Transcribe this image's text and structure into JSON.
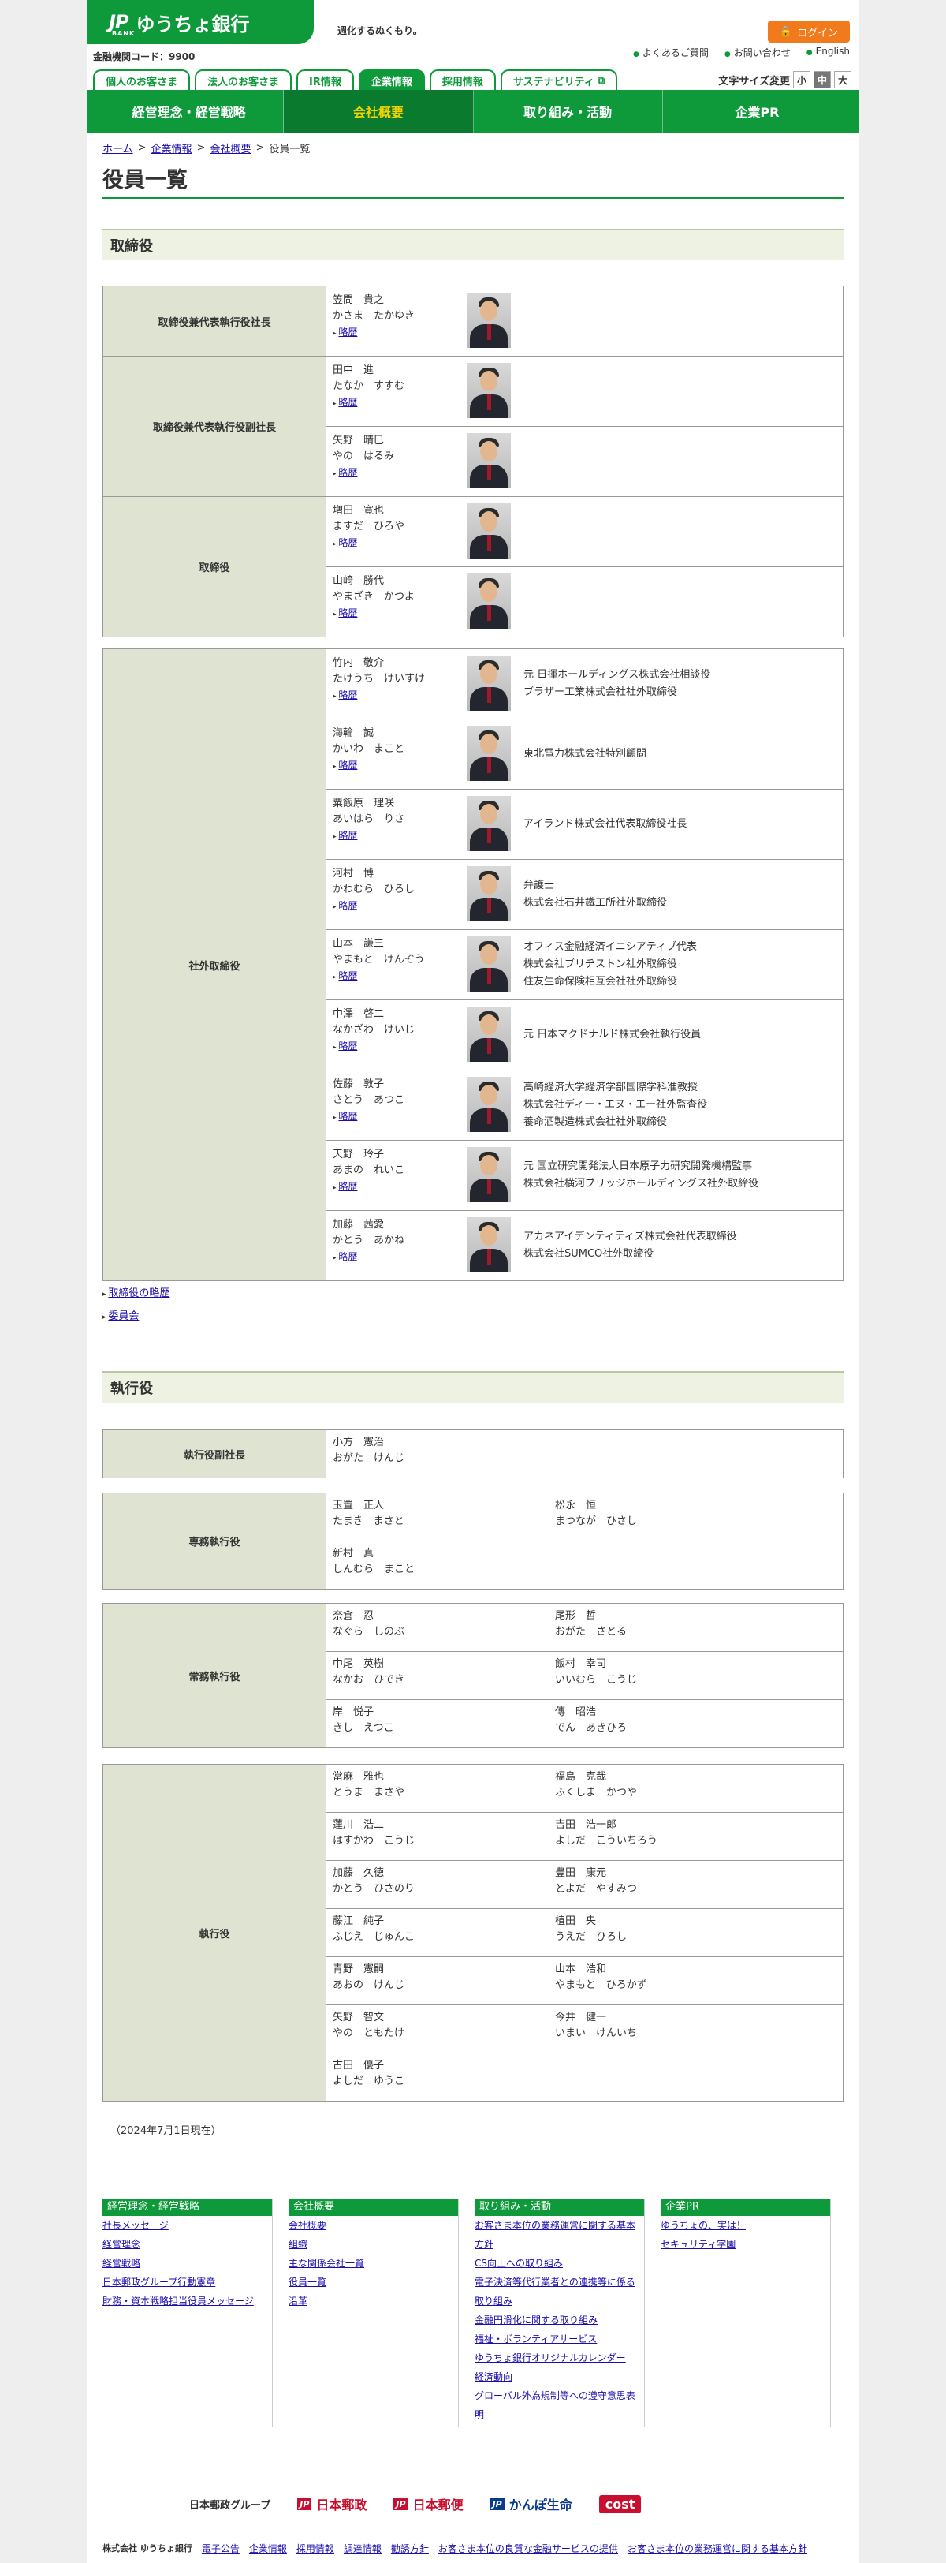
{
  "header": {
    "logo_mark": "JP",
    "logo_sub": "BANK",
    "bank_name": "ゆうちょ銀行",
    "tagline": "週化するぬくもり。",
    "fi_code": "金融機関コード：9900",
    "login": "ログイン",
    "util": [
      "よくあるご質問",
      "お問い合わせ",
      "English"
    ],
    "tabs": [
      "個人のお客さま",
      "法人のお客さま",
      "IR情報",
      "企業情報",
      "採用情報",
      "サステナビリティ"
    ],
    "font_size_label": "文字サイズ変更",
    "font_sizes": [
      "小",
      "中",
      "大"
    ],
    "nav": [
      "経営理念・経営戦略",
      "会社概要",
      "取り組み・活動",
      "企業PR"
    ]
  },
  "breadcrumb": [
    "ホーム",
    "企業情報",
    "会社概要",
    "役員一覧"
  ],
  "title": "役員一覧",
  "board": {
    "heading": "取締役",
    "history": "略歴",
    "groups": [
      {
        "role": "取締役兼代表執行役社長",
        "people": [
          {
            "name": "笠間　貴之",
            "reading": "かさま　たかゆき"
          }
        ]
      },
      {
        "role": "取締役兼代表執行役副社長",
        "people": [
          {
            "name": "田中　進",
            "reading": "たなか　すすむ"
          },
          {
            "name": "矢野　晴巳",
            "reading": "やの　はるみ"
          }
        ]
      },
      {
        "role": "取締役",
        "people": [
          {
            "name": "増田　寛也",
            "reading": "ますだ　ひろや"
          },
          {
            "name": "山崎　勝代",
            "reading": "やまざき　かつよ"
          }
        ]
      }
    ],
    "outside": {
      "role": "社外取締役",
      "people": [
        {
          "name": "竹内　敬介",
          "reading": "たけうち　けいすけ",
          "career": [
            "元 日揮ホールディングス株式会社相談役",
            "ブラザー工業株式会社社外取締役"
          ]
        },
        {
          "name": "海輪　誠",
          "reading": "かいわ　まこと",
          "career": [
            "東北電力株式会社特別顧問"
          ]
        },
        {
          "name": "粟飯原　理咲",
          "reading": "あいはら　りさ",
          "career": [
            "アイランド株式会社代表取締役社長"
          ]
        },
        {
          "name": "河村　博",
          "reading": "かわむら　ひろし",
          "career": [
            "弁護士",
            "株式会社石井鐵工所社外取締役"
          ]
        },
        {
          "name": "山本　謙三",
          "reading": "やまもと　けんぞう",
          "career": [
            "オフィス金融経済イニシアティブ代表",
            "株式会社ブリヂストン社外取締役",
            "住友生命保険相互会社社外取締役"
          ]
        },
        {
          "name": "中澤　啓二",
          "reading": "なかざわ　けいじ",
          "career": [
            "元 日本マクドナルド株式会社執行役員"
          ]
        },
        {
          "name": "佐藤　敦子",
          "reading": "さとう　あつこ",
          "career": [
            "高崎経済大学経済学部国際学科准教授",
            "株式会社ディー・エヌ・エー社外監査役",
            "養命酒製造株式会社社外取締役"
          ]
        },
        {
          "name": "天野　玲子",
          "reading": "あまの　れいこ",
          "career": [
            "元 国立研究開発法人日本原子力研究開発機構監事",
            "株式会社横河ブリッジホールディングス社外取締役"
          ]
        },
        {
          "name": "加藤　茜愛",
          "reading": "かとう　あかね",
          "career": [
            "アカネアイデンティティズ株式会社代表取締役",
            "株式会社SUMCO社外取締役"
          ]
        }
      ]
    },
    "links": [
      "取締役の略歴",
      "委員会"
    ]
  },
  "exec": {
    "heading": "執行役",
    "groups": [
      {
        "role": "執行役副社長",
        "people": [
          {
            "name": "小方　憲治",
            "reading": "おがた　けんじ"
          }
        ]
      },
      {
        "role": "専務執行役",
        "people": [
          {
            "name": "玉置　正人",
            "reading": "たまき　まさと"
          },
          {
            "name": "松永　恒",
            "reading": "まつなが　ひさし"
          },
          {
            "name": "新村　真",
            "reading": "しんむら　まこと"
          }
        ]
      },
      {
        "role": "常務執行役",
        "people": [
          {
            "name": "奈倉　忍",
            "reading": "なぐら　しのぶ"
          },
          {
            "name": "尾形　哲",
            "reading": "おがた　さとる"
          },
          {
            "name": "中尾　英樹",
            "reading": "なかお　ひでき"
          },
          {
            "name": "飯村　幸司",
            "reading": "いいむら　こうじ"
          },
          {
            "name": "岸　悦子",
            "reading": "きし　えつこ"
          },
          {
            "name": "傳　昭浩",
            "reading": "でん　あきひろ"
          }
        ]
      },
      {
        "role": "執行役",
        "people": [
          {
            "name": "當麻　雅也",
            "reading": "とうま　まさや"
          },
          {
            "name": "福島　克哉",
            "reading": "ふくしま　かつや"
          },
          {
            "name": "蓮川　浩二",
            "reading": "はすかわ　こうじ"
          },
          {
            "name": "吉田　浩一郎",
            "reading": "よしだ　こういちろう"
          },
          {
            "name": "加藤　久徳",
            "reading": "かとう　ひさのり"
          },
          {
            "name": "豊田　康元",
            "reading": "とよだ　やすみつ"
          },
          {
            "name": "藤江　純子",
            "reading": "ふじえ　じゅんこ"
          },
          {
            "name": "植田　央",
            "reading": "うえだ　ひろし"
          },
          {
            "name": "青野　憲嗣",
            "reading": "あおの　けんじ"
          },
          {
            "name": "山本　浩和",
            "reading": "やまもと　ひろかず"
          },
          {
            "name": "矢野　智文",
            "reading": "やの　ともたけ"
          },
          {
            "name": "今井　健一",
            "reading": "いまい　けんいち"
          },
          {
            "name": "古田　優子",
            "reading": "よしだ　ゆうこ"
          }
        ]
      }
    ]
  },
  "as_of": "（2024年7月1日現在）",
  "footer": {
    "cols": [
      {
        "h": "経営理念・経営戦略",
        "items": [
          "社長メッセージ",
          "経営理念",
          "経営戦略",
          "日本郵政グループ行動憲章",
          "財務・資本戦略担当役員メッセージ"
        ]
      },
      {
        "h": "会社概要",
        "items": [
          "会社概要",
          "組織",
          "主な関係会社一覧",
          "役員一覧",
          "沿革"
        ]
      },
      {
        "h": "取り組み・活動",
        "items": [
          "お客さま本位の業務運営に関する基本方針",
          "CS向上への取り組み",
          "電子決済等代行業者との連携等に係る取り組み",
          "金融円滑化に関する取り組み",
          "福祉・ボランティアサービス",
          "ゆうちょ銀行オリジナルカレンダー",
          "経済動向",
          "グローバル外為規制等への遵守意思表明"
        ]
      },
      {
        "h": "企業PR",
        "items": [
          "ゆうちょの、実は！",
          "セキュリティ字園"
        ]
      }
    ],
    "group_label": "日本郵政グループ",
    "group": [
      "日本郵政",
      "日本郵便",
      "かんぽ生命",
      "cost"
    ],
    "company": "株式会社 ゆうちょ銀行",
    "bottom": [
      "電子公告",
      "企業情報",
      "採用情報",
      "調達情報",
      "勧誘方針",
      "お客さま本位の良質な金融サービスの提供",
      "お客さま本位の業務運営に関する基本方針"
    ]
  },
  "colors": {
    "brand_green": "#0e9a3b",
    "login_orange": "#f07a1c"
  }
}
